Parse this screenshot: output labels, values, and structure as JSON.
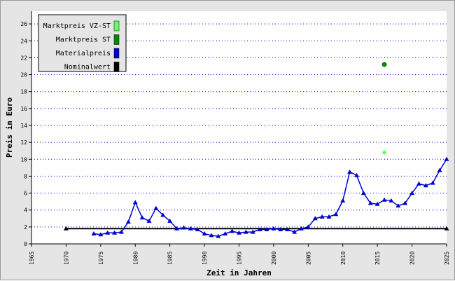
{
  "chart_data": {
    "type": "line",
    "title": "",
    "xlabel": "Zeit in Jahren",
    "ylabel": "Preis in Euro",
    "xlim": [
      1965,
      2025
    ],
    "ylim": [
      0,
      27.5
    ],
    "x_ticks": [
      1965,
      1970,
      1975,
      1980,
      1985,
      1990,
      1995,
      2000,
      2005,
      2010,
      2015,
      2020,
      2025
    ],
    "y_ticks": [
      0,
      2,
      4,
      6,
      8,
      10,
      12,
      14,
      16,
      18,
      20,
      22,
      24,
      26
    ],
    "grid": "horizontal dotted",
    "legend_position": "top-left",
    "series": [
      {
        "name": "Marktpreis VZ-ST",
        "color": "#66ff66",
        "marker": "diamond",
        "x": [
          2016
        ],
        "y": [
          10.8
        ]
      },
      {
        "name": "Marktpreis ST",
        "color": "#008800",
        "marker": "circle",
        "x": [
          2016
        ],
        "y": [
          21.2
        ]
      },
      {
        "name": "Materialpreis",
        "color": "#0000cc",
        "marker": "triangle",
        "x": [
          1974,
          1975,
          1976,
          1977,
          1978,
          1979,
          1980,
          1981,
          1982,
          1983,
          1984,
          1985,
          1986,
          1987,
          1988,
          1989,
          1990,
          1991,
          1992,
          1993,
          1994,
          1995,
          1996,
          1997,
          1998,
          1999,
          2000,
          2001,
          2002,
          2003,
          2004,
          2005,
          2006,
          2007,
          2008,
          2009,
          2010,
          2011,
          2012,
          2013,
          2014,
          2015,
          2016,
          2017,
          2018,
          2019,
          2020,
          2021,
          2022,
          2023,
          2024,
          2025
        ],
        "y": [
          1.2,
          1.1,
          1.3,
          1.3,
          1.4,
          2.6,
          4.9,
          3.1,
          2.7,
          4.2,
          3.4,
          2.7,
          1.8,
          1.9,
          1.8,
          1.7,
          1.2,
          1.0,
          0.9,
          1.2,
          1.5,
          1.3,
          1.4,
          1.4,
          1.7,
          1.7,
          1.8,
          1.7,
          1.7,
          1.4,
          1.8,
          2.0,
          3.0,
          3.2,
          3.2,
          3.5,
          5.1,
          8.5,
          8.1,
          6.0,
          4.8,
          4.7,
          5.2,
          5.1,
          4.5,
          4.8,
          6.0,
          7.1,
          6.9,
          7.2,
          8.7,
          10.0
        ]
      },
      {
        "name": "Nominalwert",
        "color": "#000000",
        "marker": "triangle",
        "x": [
          1970,
          2025
        ],
        "y": [
          1.8,
          1.8
        ]
      }
    ]
  }
}
